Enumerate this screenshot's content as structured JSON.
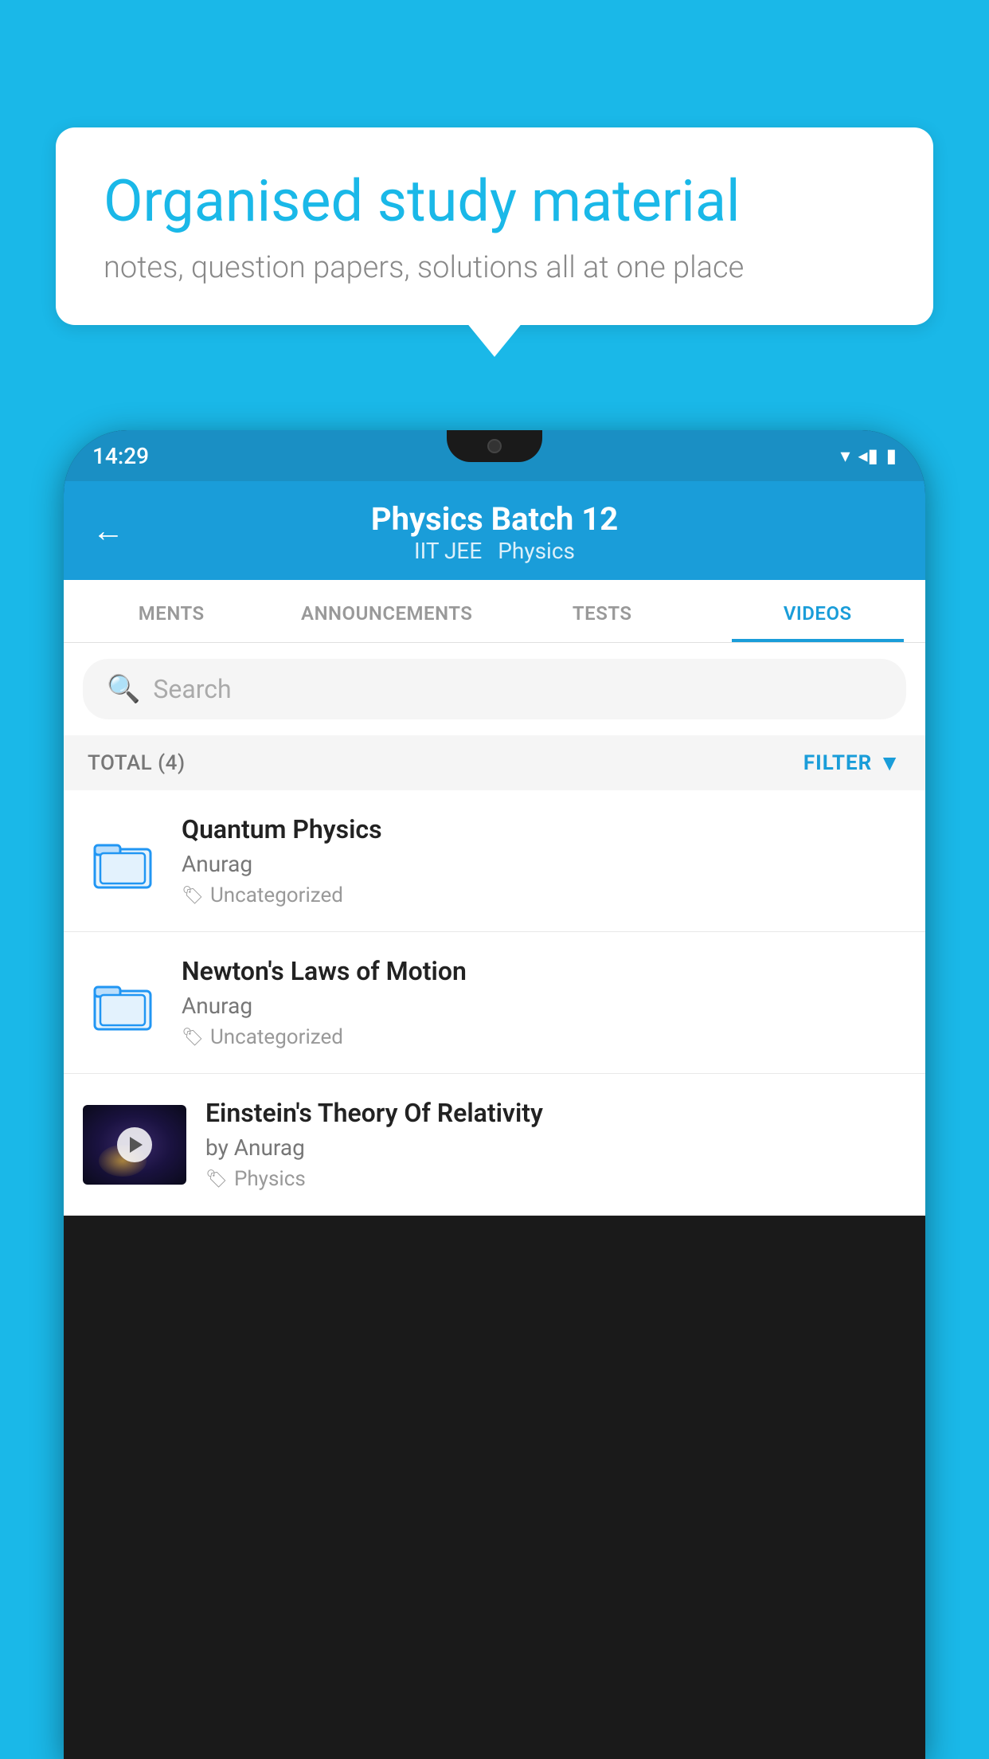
{
  "background_color": "#1ab8e8",
  "bubble": {
    "title": "Organised study material",
    "subtitle": "notes, question papers, solutions all at one place"
  },
  "status_bar": {
    "time": "14:29",
    "icons": "▾◂▮"
  },
  "header": {
    "back_label": "←",
    "title": "Physics Batch 12",
    "subtitle_left": "IIT JEE",
    "subtitle_right": "Physics"
  },
  "tabs": [
    {
      "label": "MENTS",
      "active": false
    },
    {
      "label": "ANNOUNCEMENTS",
      "active": false
    },
    {
      "label": "TESTS",
      "active": false
    },
    {
      "label": "VIDEOS",
      "active": true
    }
  ],
  "search": {
    "placeholder": "Search"
  },
  "filter_row": {
    "total_label": "TOTAL (4)",
    "filter_label": "FILTER"
  },
  "videos": [
    {
      "id": 1,
      "title": "Quantum Physics",
      "author": "Anurag",
      "tag": "Uncategorized",
      "type": "folder",
      "has_thumb": false
    },
    {
      "id": 2,
      "title": "Newton's Laws of Motion",
      "author": "Anurag",
      "tag": "Uncategorized",
      "type": "folder",
      "has_thumb": false
    },
    {
      "id": 3,
      "title": "Einstein's Theory Of Relativity",
      "author": "by Anurag",
      "tag": "Physics",
      "type": "video",
      "has_thumb": true
    }
  ]
}
